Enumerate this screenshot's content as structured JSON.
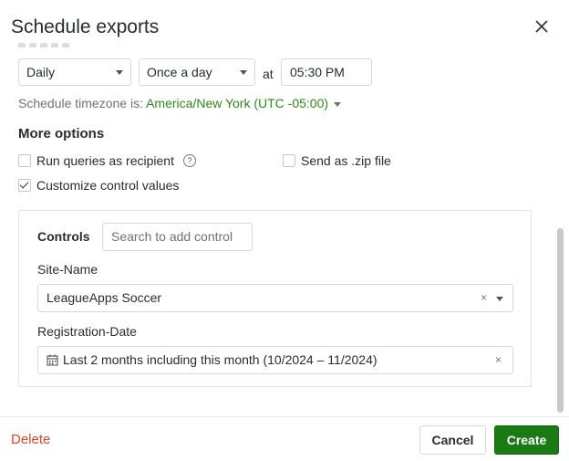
{
  "dialog": {
    "title": "Schedule exports"
  },
  "schedule": {
    "frequency": "Daily",
    "interval": "Once a day",
    "at_label": "at",
    "time": "05:30 PM",
    "timezone_prefix": "Schedule timezone is:",
    "timezone_value": "America/New York (UTC -05:00)"
  },
  "more_options": {
    "title": "More options",
    "run_queries_label": "Run queries as recipient",
    "run_queries_checked": false,
    "send_zip_label": "Send as .zip file",
    "send_zip_checked": false,
    "customize_label": "Customize control values",
    "customize_checked": true
  },
  "controls": {
    "label": "Controls",
    "search_placeholder": "Search to add control",
    "fields": [
      {
        "label": "Site-Name",
        "value": "LeagueApps Soccer"
      },
      {
        "label": "Registration-Date",
        "value": "Last 2 months including this month (10/2024 – 11/2024)"
      }
    ]
  },
  "footer": {
    "delete_label": "Delete",
    "cancel_label": "Cancel",
    "create_label": "Create"
  },
  "colors": {
    "accent_green": "#1a7a14",
    "link_green": "#2b8a1a",
    "danger": "#e0452e"
  }
}
